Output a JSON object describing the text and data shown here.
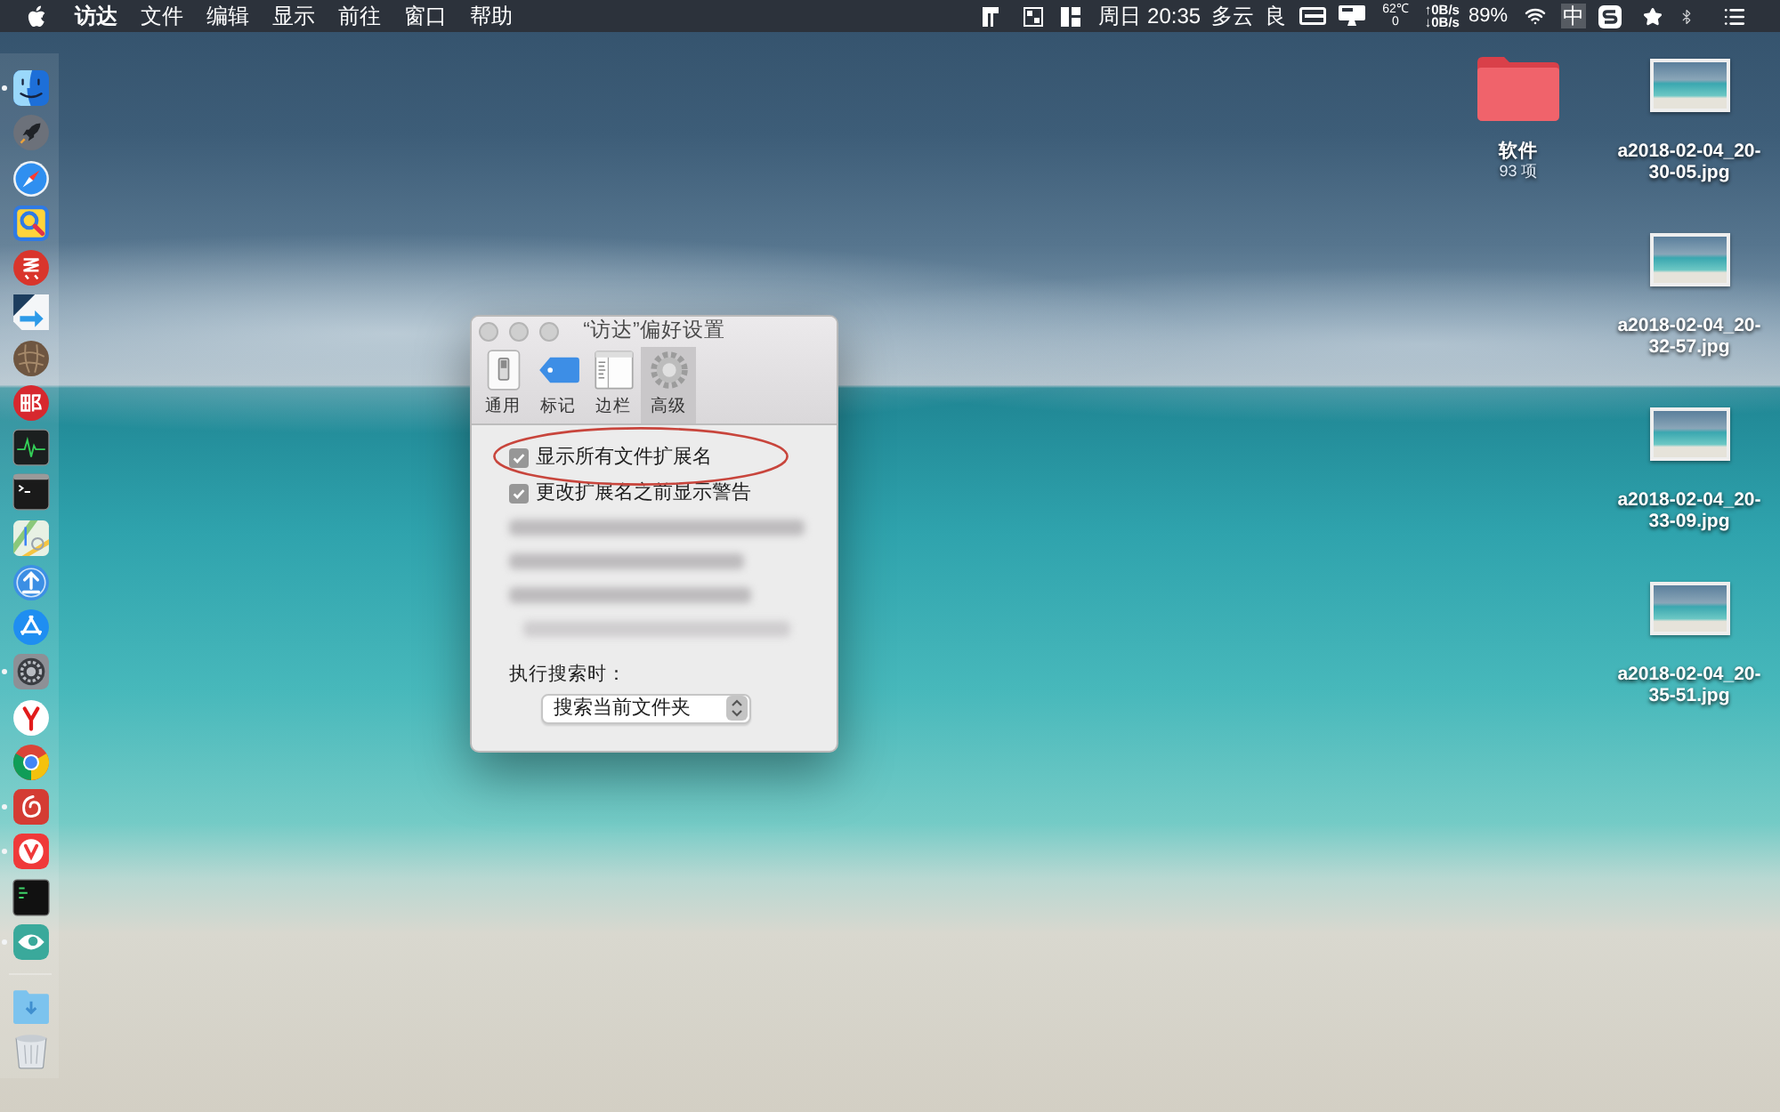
{
  "menu_bar": {
    "menus": [
      "访达",
      "文件",
      "编辑",
      "显示",
      "前往",
      "窗口",
      "帮助"
    ],
    "clock": "周日 20:35",
    "weather": "多云",
    "air_quality": "良",
    "sensor": [
      "62℃",
      "0"
    ],
    "network": [
      "↑0B/s",
      "↓0B/s"
    ],
    "battery": "89%",
    "input_method": "中"
  },
  "dock": {
    "apps": [
      {
        "running": true
      },
      {
        "running": false
      },
      {
        "running": false
      },
      {
        "running": false
      },
      {
        "running": false
      },
      {
        "running": false
      },
      {
        "running": false
      },
      {
        "running": false
      },
      {
        "running": false
      },
      {
        "running": false
      },
      {
        "running": false
      },
      {
        "running": false
      },
      {
        "running": false
      },
      {
        "running": true
      },
      {
        "running": false
      },
      {
        "running": false
      },
      {
        "running": true
      },
      {
        "running": true
      },
      {
        "running": false
      },
      {
        "running": true
      }
    ],
    "stacks": [
      {
        "running": false
      },
      {
        "running": false
      }
    ]
  },
  "desktop_items": [
    {
      "kind": "folder",
      "name": "软件",
      "detail": "93 项"
    },
    {
      "kind": "image",
      "name": "a2018-02-04_20-30-05.jpg"
    },
    {
      "kind": "image",
      "name": "a2018-02-04_20-32-57.jpg"
    },
    {
      "kind": "image",
      "name": "a2018-02-04_20-33-09.jpg"
    },
    {
      "kind": "image",
      "name": "a2018-02-04_20-35-51.jpg"
    }
  ],
  "preferences_window": {
    "title": "“访达”偏好设置",
    "tabs": [
      {
        "label": "通用",
        "selected": false
      },
      {
        "label": "标记",
        "selected": false
      },
      {
        "label": "边栏",
        "selected": false
      },
      {
        "label": "高级",
        "selected": true
      }
    ],
    "options": [
      {
        "label": "显示所有文件扩展名",
        "checked": true
      },
      {
        "label": "更改扩展名之前显示警告",
        "checked": true
      }
    ],
    "search_label": "执行搜索时：",
    "search_scope": "搜索当前文件夹"
  }
}
